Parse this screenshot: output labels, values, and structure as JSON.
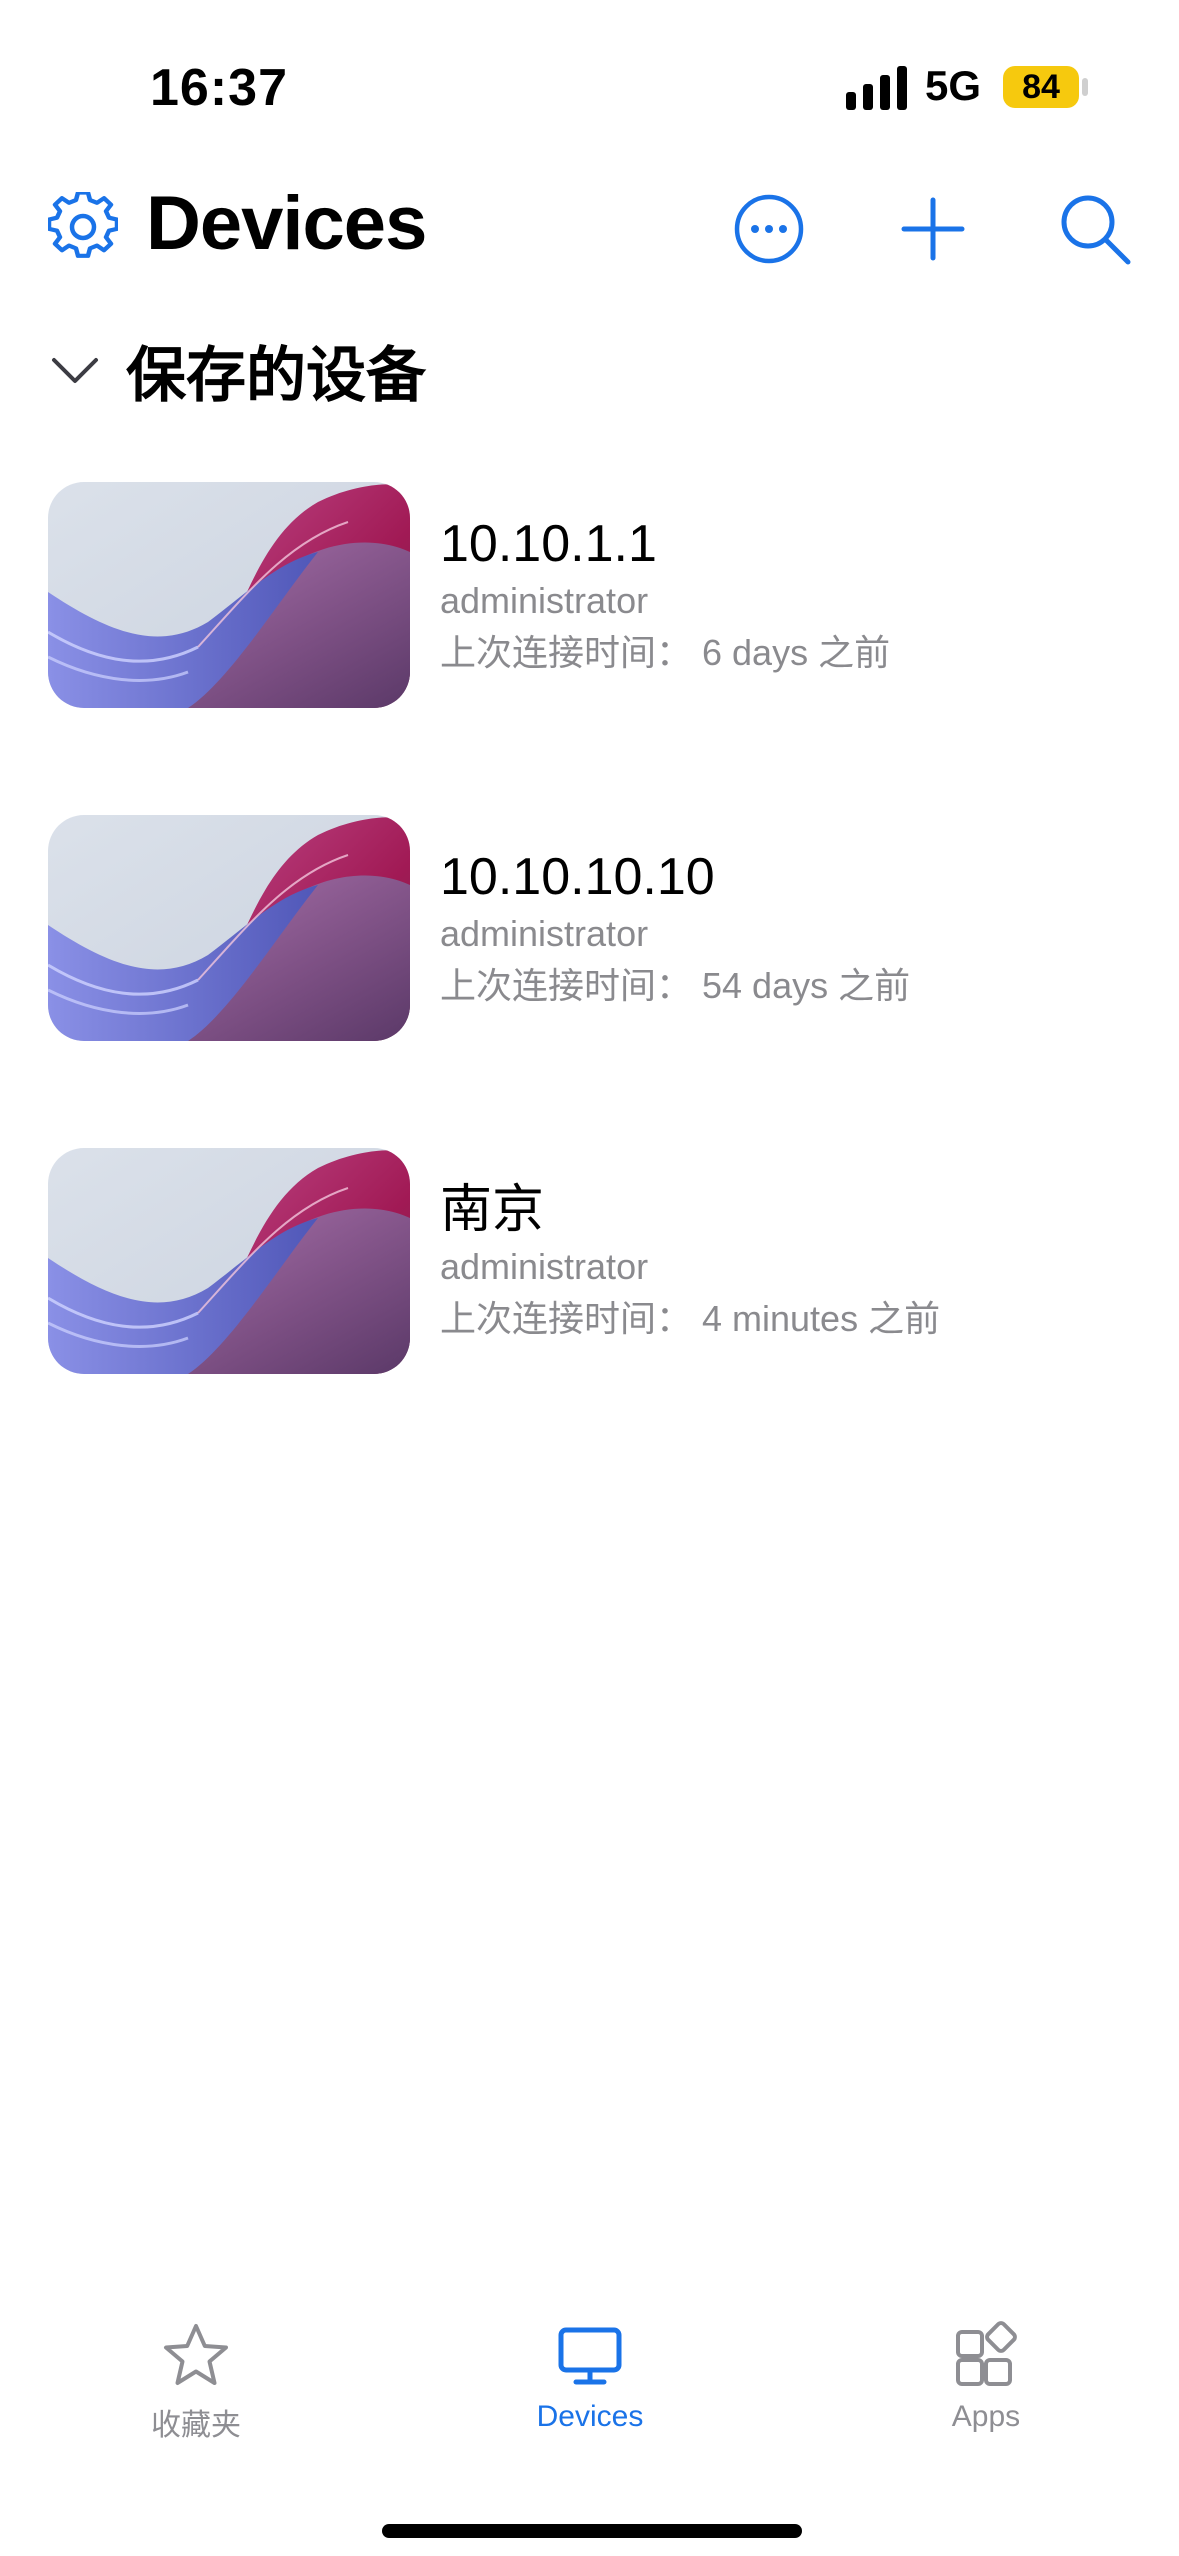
{
  "status_bar": {
    "time": "16:37",
    "network": "5G",
    "battery": "84",
    "battery_color": "#f6c90e"
  },
  "header": {
    "title": "Devices",
    "settings_icon": "gear-icon",
    "actions": [
      "more-icon",
      "plus-icon",
      "search-icon"
    ],
    "accent": "#1a73e8"
  },
  "section": {
    "title": "保存的设备",
    "expanded": true
  },
  "devices": [
    {
      "name": "10.10.1.1",
      "user": "administrator",
      "last_connected": "上次连接时间： 6 days 之前"
    },
    {
      "name": "10.10.10.10",
      "user": "administrator",
      "last_connected": "上次连接时间： 54 days 之前"
    },
    {
      "name": "南京",
      "user": "administrator",
      "last_connected": "上次连接时间： 4 minutes 之前"
    }
  ],
  "tabbar": {
    "tabs": [
      {
        "label": "收藏夹",
        "icon": "star-icon",
        "active": false
      },
      {
        "label": "Devices",
        "icon": "monitor-icon",
        "active": true
      },
      {
        "label": "Apps",
        "icon": "apps-icon",
        "active": false
      }
    ]
  }
}
